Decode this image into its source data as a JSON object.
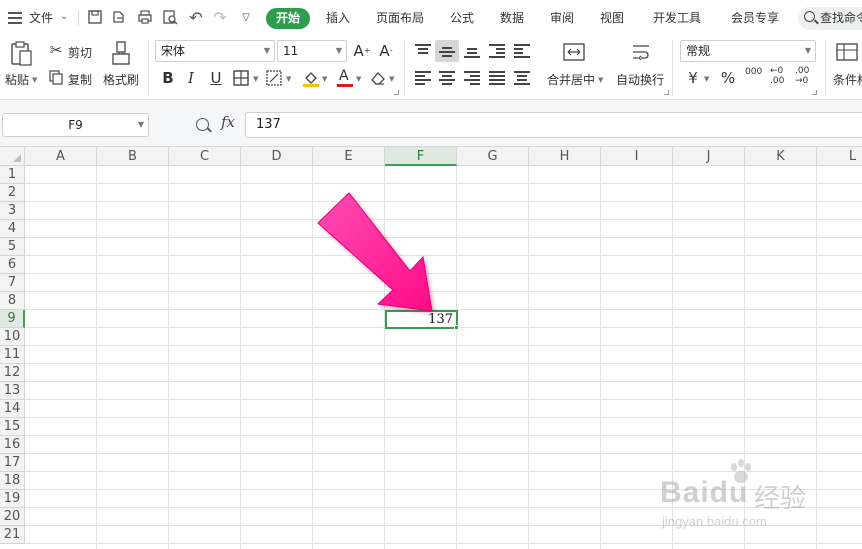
{
  "menu": {
    "file_label": "文件",
    "tabs": [
      "开始",
      "插入",
      "页面布局",
      "公式",
      "数据",
      "审阅",
      "视图",
      "开发工具",
      "会员专享"
    ],
    "active_tab": "开始",
    "search_text": "查找命令"
  },
  "ribbon": {
    "paste_label": "粘贴",
    "cut_label": "剪切",
    "copy_label": "复制",
    "format_painter_label": "格式刷",
    "font_name": "宋体",
    "font_size": "11",
    "merge_label": "合并居中",
    "wrap_label": "自动换行",
    "number_format": "常规",
    "conditional_label": "条件格"
  },
  "formula_bar": {
    "name_box": "F9",
    "fx_label": "fx",
    "formula_value": "137"
  },
  "grid": {
    "columns": [
      "A",
      "B",
      "C",
      "D",
      "E",
      "F",
      "G",
      "H",
      "I",
      "J",
      "K",
      "L"
    ],
    "rows": [
      "1",
      "2",
      "3",
      "4",
      "5",
      "6",
      "7",
      "8",
      "9",
      "10",
      "11",
      "12",
      "13",
      "14",
      "15",
      "16",
      "17",
      "18",
      "19",
      "20",
      "21"
    ],
    "selected_column": "F",
    "selected_row": "9",
    "selected_cell": "F9",
    "selected_value": "137"
  },
  "watermark": {
    "brand": "Baidu",
    "brand_suffix": "经验",
    "url": "jingyan.baidu.com"
  },
  "colors": {
    "accent_green": "#2e9d4f",
    "arrow_pink": "#ff1493"
  }
}
